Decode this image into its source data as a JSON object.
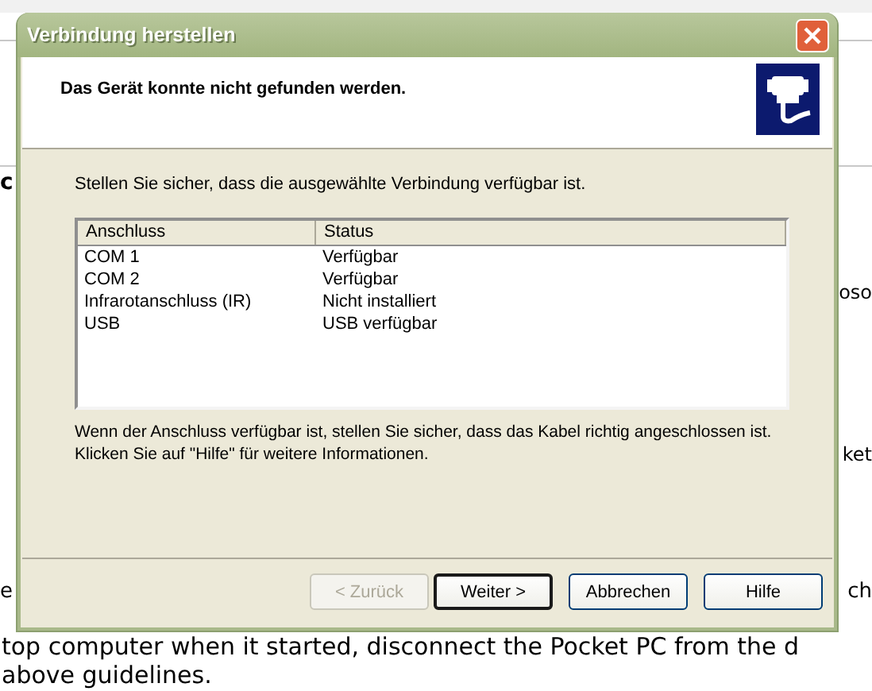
{
  "background_page": {
    "left_fragments": [
      {
        "text": "c",
        "kind": "heading"
      },
      {
        "text": "e",
        "kind": "large"
      }
    ],
    "right_fragments": [
      {
        "text": "oso",
        "kind": "body"
      },
      {
        "text": "ket",
        "kind": "body"
      },
      {
        "text": "ch",
        "kind": "large"
      }
    ],
    "lines": [
      "top computer when it started, disconnect the Pocket PC from the d",
      "above guidelines."
    ]
  },
  "dialog": {
    "title": "Verbindung herstellen",
    "heading": "Das Gerät konnte nicht gefunden werden.",
    "instruction": "Stellen Sie sicher, dass die ausgewählte Verbindung verfügbar ist.",
    "list": {
      "columns": [
        "Anschluss",
        "Status"
      ],
      "rows": [
        {
          "cells": [
            "COM 1",
            "Verfügbar"
          ]
        },
        {
          "cells": [
            "COM 2",
            "Verfügbar"
          ]
        },
        {
          "cells": [
            "Infrarotanschluss (IR)",
            "Nicht installiert"
          ]
        },
        {
          "cells": [
            "USB",
            "USB verfügbar"
          ]
        }
      ]
    },
    "note_lines": [
      "Wenn der Anschluss verfügbar ist, stellen Sie sicher, dass das Kabel richtig angeschlossen ist.",
      "Klicken Sie auf \"Hilfe\" für weitere Informationen."
    ],
    "buttons": [
      {
        "label": "< Zurück",
        "disabled": true,
        "default": false
      },
      {
        "label": "Weiter >",
        "disabled": false,
        "default": true
      },
      {
        "label": "Abbrechen",
        "disabled": false,
        "default": false
      },
      {
        "label": "Hilfe",
        "disabled": false,
        "default": false
      }
    ]
  }
}
